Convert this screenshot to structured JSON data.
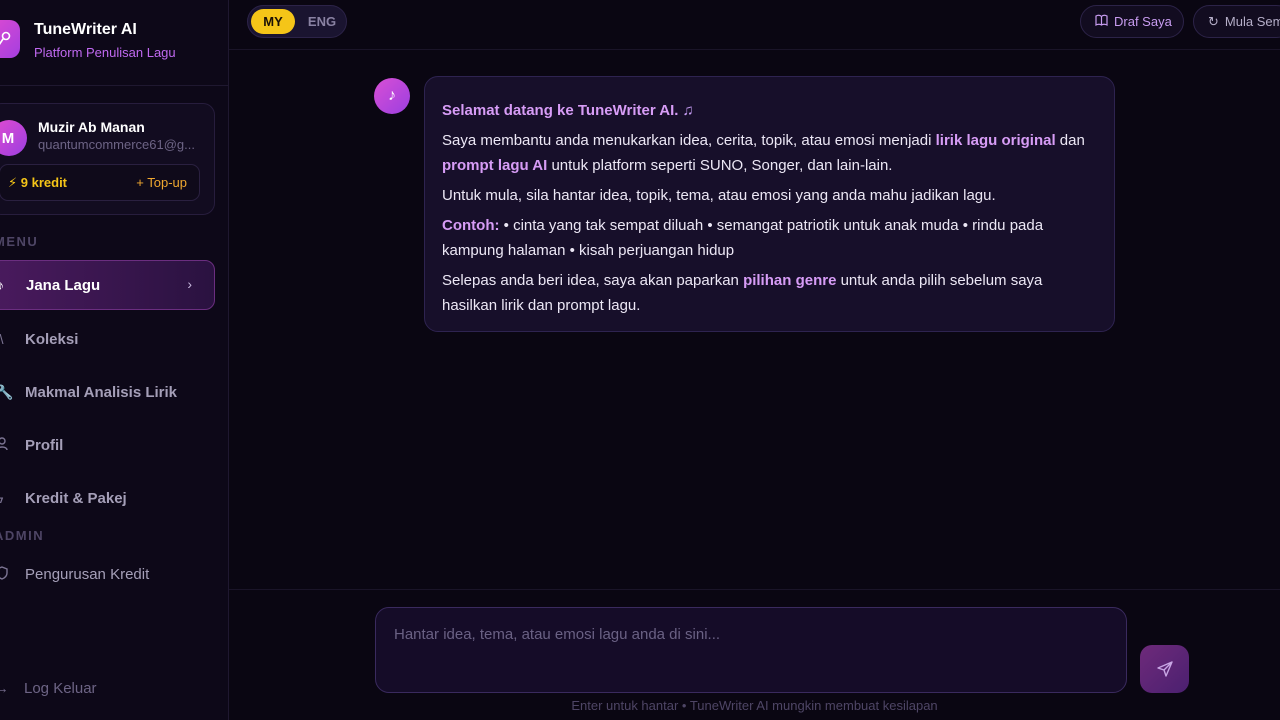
{
  "brand": {
    "title": "TuneWriter AI",
    "subtitle": "Platform Penulisan Lagu"
  },
  "user": {
    "initial": "M",
    "name": "Muzir Ab Manan",
    "email": "quantumcommerce61@g...",
    "credits": "9 kredit",
    "topup": "+ Top-up"
  },
  "sidebar": {
    "menu_label": "MENU",
    "admin_label": "ADMIN",
    "items": [
      {
        "label": "Jana Lagu",
        "icon": "music-note-icon"
      },
      {
        "label": "Koleksi",
        "icon": "library-icon"
      },
      {
        "label": "Makmal Analisis Lirik",
        "icon": "wrench-icon"
      },
      {
        "label": "Profil",
        "icon": "user-icon"
      },
      {
        "label": "Kredit & Pakej",
        "icon": "lightning-icon"
      }
    ],
    "admin_items": [
      {
        "label": "Pengurusan Kredit",
        "icon": "shield-icon"
      }
    ],
    "logout": "Log Keluar"
  },
  "topbar": {
    "lang_my": "MY",
    "lang_eng": "ENG",
    "draft": "Draf Saya",
    "restart": "Mula Semula"
  },
  "chat": {
    "welcome": "Selamat datang ke TuneWriter AI.",
    "p1_a": "Saya membantu anda menukarkan idea, cerita, topik, atau emosi menjadi ",
    "p1_hl1": "lirik lagu original",
    "p1_b": " dan ",
    "p1_hl2": "prompt lagu AI",
    "p1_c": " untuk platform seperti SUNO, Songer, dan lain-lain.",
    "p2": "Untuk mula, sila hantar idea, topik, tema, atau emosi yang anda mahu jadikan lagu.",
    "p3_hl": "Contoh:",
    "p3": " • cinta yang tak sempat diluah • semangat patriotik untuk anak muda • rindu pada kampung halaman • kisah perjuangan hidup",
    "p4_a": "Selepas anda beri idea, saya akan paparkan ",
    "p4_hl": "pilihan genre",
    "p4_b": " untuk anda pilih sebelum saya hasilkan lirik dan prompt lagu."
  },
  "composer": {
    "placeholder": "Hantar idea, tema, atau emosi lagu anda di sini...",
    "hint": "Enter untuk hantar • TuneWriter AI mungkin membuat kesilapan"
  }
}
